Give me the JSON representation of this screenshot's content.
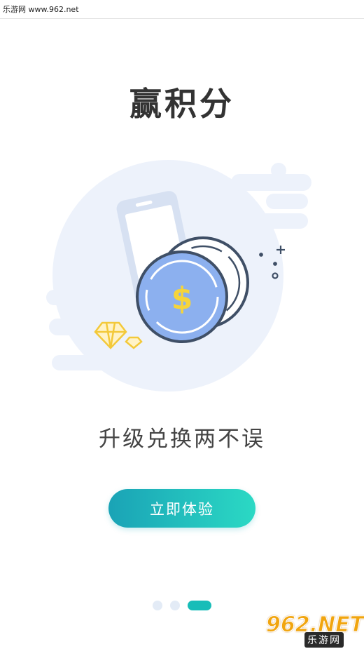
{
  "watermark": {
    "top_text": "乐游网 www.962.net",
    "logo_num": "962.NET",
    "logo_sub": "乐游网"
  },
  "title": "赢积分",
  "subtitle": "升级兑换两不误",
  "cta_label": "立即体验",
  "pager": {
    "total": 3,
    "active_index": 3
  },
  "colors": {
    "accent_start": "#1aa3b6",
    "accent_end": "#2bd9c4",
    "illustration_bg": "#edf2fb",
    "coin": "#8cb0ef",
    "dollar": "#f6d43a",
    "diamond": "#f3c93a"
  },
  "icons": [
    "phone-icon",
    "coin-icon",
    "dollar-sign-icon",
    "diamond-icon",
    "plus-sparkle-icon"
  ]
}
